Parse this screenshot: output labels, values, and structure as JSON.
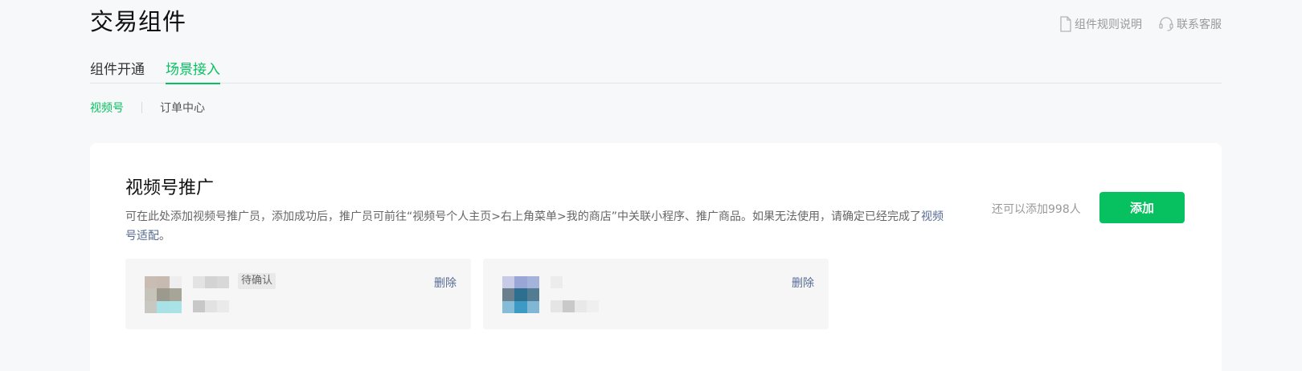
{
  "page": {
    "title": "交易组件"
  },
  "top_links": {
    "rules": {
      "label": "组件规则说明",
      "icon": "document-icon"
    },
    "support": {
      "label": "联系客服",
      "icon": "headset-icon"
    }
  },
  "tabs": [
    {
      "label": "组件开通",
      "active": false
    },
    {
      "label": "场景接入",
      "active": true
    }
  ],
  "subnav": [
    {
      "label": "视频号",
      "active": true
    },
    {
      "label": "订单中心",
      "active": false
    }
  ],
  "card": {
    "title": "视频号推广",
    "desc_text": "可在此处添加视频号推广员，添加成功后，推广员可前往“视频号个人主页>右上角菜单>我的商店”中关联小程序、推广商品。如果无法使用，请确定已经完成了",
    "desc_link": "视频号适配",
    "desc_end": "。",
    "quota_text": "还可以添加998人",
    "add_button": "添加"
  },
  "members": [
    {
      "status": "待确认",
      "delete_label": "删除"
    },
    {
      "status": "",
      "delete_label": "删除"
    }
  ],
  "colors": {
    "accent": "#07c160",
    "link": "#576b95",
    "background": "#f7f8fa"
  }
}
